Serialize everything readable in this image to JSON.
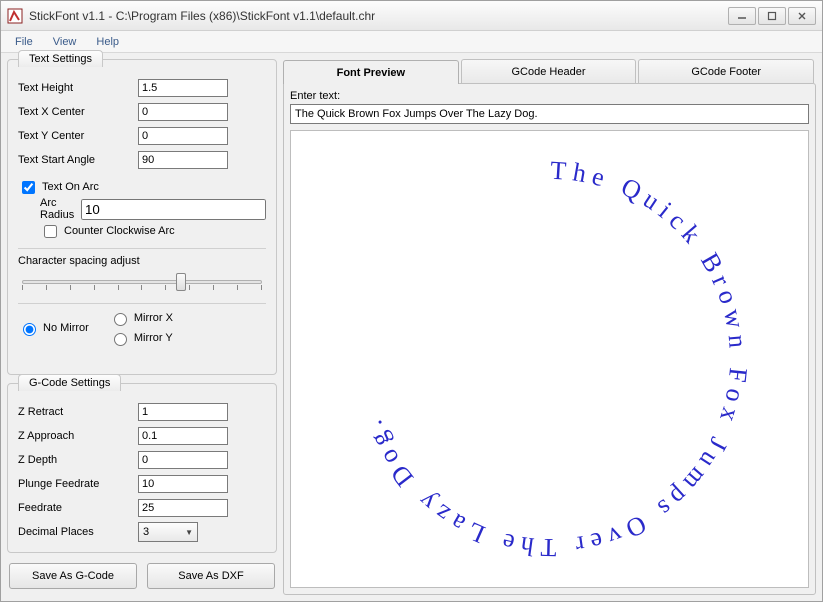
{
  "window": {
    "title": "StickFont v1.1 - C:\\Program Files (x86)\\StickFont v1.1\\default.chr"
  },
  "menu": {
    "file": "File",
    "view": "View",
    "help": "Help"
  },
  "text_settings": {
    "legend": "Text Settings",
    "text_height_label": "Text Height",
    "text_height": "1.5",
    "text_x_center_label": "Text X Center",
    "text_x_center": "0",
    "text_y_center_label": "Text Y Center",
    "text_y_center": "0",
    "text_start_angle_label": "Text Start Angle",
    "text_start_angle": "90",
    "text_on_arc_label": "Text On Arc",
    "text_on_arc_checked": true,
    "arc_radius_label": "Arc Radius",
    "arc_radius": "10",
    "ccw_label": "Counter Clockwise Arc",
    "ccw_checked": false,
    "spacing_label": "Character spacing adjust",
    "mirror": {
      "no_mirror": "No Mirror",
      "mirror_x": "Mirror X",
      "mirror_y": "Mirror Y",
      "selected": "no_mirror"
    }
  },
  "gcode_settings": {
    "legend": "G-Code Settings",
    "z_retract_label": "Z Retract",
    "z_retract": "1",
    "z_approach_label": "Z Approach",
    "z_approach": "0.1",
    "z_depth_label": "Z Depth",
    "z_depth": "0",
    "plunge_feedrate_label": "Plunge Feedrate",
    "plunge_feedrate": "10",
    "feedrate_label": "Feedrate",
    "feedrate": "25",
    "decimal_places_label": "Decimal Places",
    "decimal_places": "3"
  },
  "buttons": {
    "save_gcode": "Save As G-Code",
    "save_dxf": "Save As DXF"
  },
  "tabs": {
    "preview": "Font Preview",
    "header": "GCode Header",
    "footer": "GCode Footer",
    "active": "preview"
  },
  "preview": {
    "enter_text_label": "Enter text:",
    "enter_text_value": "The Quick Brown Fox Jumps Over The Lazy Dog.",
    "arc_display": "The Quick Brown Fox Jumps Over The Lazy Dog. "
  }
}
